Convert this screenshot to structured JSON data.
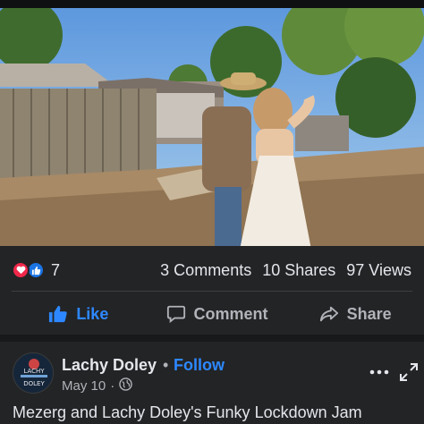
{
  "video": {
    "description_icon": "video-frame"
  },
  "reactions": {
    "icons": [
      "love-icon",
      "like-icon"
    ],
    "count": "7",
    "love_color": "#f0284a",
    "like_color": "#1b74e4"
  },
  "stats": {
    "comments": "3 Comments",
    "shares": "10 Shares",
    "views": "97 Views"
  },
  "actions": {
    "like_label": "Like",
    "comment_label": "Comment",
    "share_label": "Share",
    "like_color": "#2d88ff"
  },
  "post": {
    "author": "Lachy Doley",
    "separator": "•",
    "follow_label": "Follow",
    "date": "May 10",
    "date_separator": "·",
    "privacy_icon": "globe-icon",
    "title": "Mezerg and Lachy Doley's Funky Lockdown Jam"
  },
  "avatar": {
    "line1": "LACHY",
    "line2": "DOLEY"
  }
}
